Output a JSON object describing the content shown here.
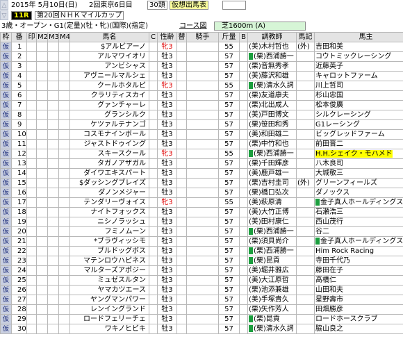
{
  "header": {
    "date": "2015年 5月10日(日)",
    "meeting": "2回東京6日目",
    "heads": "30頭",
    "status": "仮想出馬表",
    "race_no": "11R",
    "race_name": "第20回ＮＨＫマイルカップ",
    "conditions": "3歳・オープン・G1(定量)(牡・牝)(国際)(指定)",
    "course_label": "コース図",
    "course": "芝1600m (A)",
    "nav_up": "△",
    "nav_down": "▽"
  },
  "columns": [
    "枠",
    "番",
    "印",
    "M2",
    "M3",
    "M4",
    "馬名",
    "C",
    "性齢",
    "替",
    "騎手",
    "斤量",
    "B",
    "調教師",
    "馬記",
    "馬主"
  ],
  "rows": [
    {
      "waku": "仮",
      "ban": "1",
      "name": "$アルビアーノ",
      "sex": "牝3",
      "f": true,
      "kin": "55",
      "tr": "(美)木村哲也",
      "mark": false,
      "note": "(外)",
      "owner": "吉田和美",
      "hl": false
    },
    {
      "waku": "仮",
      "ban": "2",
      "name": "アルマワイオリ",
      "sex": "牡3",
      "f": false,
      "kin": "57",
      "tr": "(栗)西浦勝一",
      "mark": true,
      "note": "",
      "owner": "コウトミックレーシング",
      "hl": false
    },
    {
      "waku": "仮",
      "ban": "3",
      "name": "アンビシャス",
      "sex": "牡3",
      "f": false,
      "kin": "57",
      "tr": "(栗)音無秀孝",
      "mark": false,
      "note": "",
      "owner": "近藤英子",
      "hl": false
    },
    {
      "waku": "仮",
      "ban": "4",
      "name": "アヴニールマルシェ",
      "sex": "牡3",
      "f": false,
      "kin": "57",
      "tr": "(美)藤沢和雄",
      "mark": false,
      "note": "",
      "owner": "キャロットファーム",
      "hl": false
    },
    {
      "waku": "仮",
      "ban": "5",
      "name": "クールホタルビ",
      "sex": "牝3",
      "f": true,
      "kin": "55",
      "tr": "(栗)清水久詞",
      "mark": true,
      "note": "",
      "owner": "川上哲司",
      "hl": false
    },
    {
      "waku": "仮",
      "ban": "6",
      "name": "クラリティスカイ",
      "sex": "牡3",
      "f": false,
      "kin": "57",
      "tr": "(栗)友道康夫",
      "mark": false,
      "note": "",
      "owner": "杉山忠国",
      "hl": false
    },
    {
      "waku": "仮",
      "ban": "7",
      "name": "グァンチャーレ",
      "sex": "牡3",
      "f": false,
      "kin": "57",
      "tr": "(栗)北出成人",
      "mark": false,
      "note": "",
      "owner": "松本俊廣",
      "hl": false
    },
    {
      "waku": "仮",
      "ban": "8",
      "name": "グランシルク",
      "sex": "牡3",
      "f": false,
      "kin": "57",
      "tr": "(美)戸田博文",
      "mark": false,
      "note": "",
      "owner": "シルクレーシング",
      "hl": false
    },
    {
      "waku": "仮",
      "ban": "9",
      "name": "ケツァルテナンゴ",
      "sex": "牡3",
      "f": false,
      "kin": "57",
      "tr": "(栗)笹田和秀",
      "mark": false,
      "note": "",
      "owner": "G1レーシング",
      "hl": false
    },
    {
      "waku": "仮",
      "ban": "10",
      "name": "コスモナインボール",
      "sex": "牡3",
      "f": false,
      "kin": "57",
      "tr": "(美)和田雄二",
      "mark": false,
      "note": "",
      "owner": "ビッグレッドファーム",
      "hl": false
    },
    {
      "waku": "仮",
      "ban": "11",
      "name": "ジャストドゥイング",
      "sex": "牡3",
      "f": false,
      "kin": "57",
      "tr": "(栗)中竹和也",
      "mark": false,
      "note": "",
      "owner": "前田晋二",
      "hl": false
    },
    {
      "waku": "仮",
      "ban": "12",
      "name": "スキースクール",
      "sex": "牝3",
      "f": true,
      "kin": "55",
      "tr": "(栗)西浦勝一",
      "mark": true,
      "note": "",
      "owner": "H.H.シェイク・モハメド",
      "hl": true
    },
    {
      "waku": "仮",
      "ban": "13",
      "name": "タガノアザガル",
      "sex": "牡3",
      "f": false,
      "kin": "57",
      "tr": "(栗)千田輝彦",
      "mark": false,
      "note": "",
      "owner": "八木良司",
      "hl": false
    },
    {
      "waku": "仮",
      "ban": "14",
      "name": "ダイワエキスパート",
      "sex": "牡3",
      "f": false,
      "kin": "57",
      "tr": "(美)鹿戸雄一",
      "mark": false,
      "note": "",
      "owner": "大城敬三",
      "hl": false
    },
    {
      "waku": "仮",
      "ban": "15",
      "name": "$ダッシングブレイズ",
      "sex": "牡3",
      "f": false,
      "kin": "57",
      "tr": "(栗)吉村圭司",
      "mark": false,
      "note": "(外)",
      "owner": "グリーンフィールズ",
      "hl": false
    },
    {
      "waku": "仮",
      "ban": "16",
      "name": "ダノンメジャー",
      "sex": "牡3",
      "f": false,
      "kin": "57",
      "tr": "(栗)橋口弘次",
      "mark": false,
      "note": "",
      "owner": "ダノックス",
      "hl": false
    },
    {
      "waku": "仮",
      "ban": "17",
      "name": "テンダリーヴォイス",
      "sex": "牝3",
      "f": true,
      "kin": "55",
      "tr": "(美)萩原清",
      "mark": false,
      "note": "",
      "owner": "金子真人ホールディングス",
      "hl": false,
      "ownermark": true
    },
    {
      "waku": "仮",
      "ban": "18",
      "name": "ナイトフォックス",
      "sex": "牡3",
      "f": false,
      "kin": "57",
      "tr": "(美)大竹正博",
      "mark": false,
      "note": "",
      "owner": "石瀬浩三",
      "hl": false
    },
    {
      "waku": "仮",
      "ban": "19",
      "name": "ニシノラッシュ",
      "sex": "牡3",
      "f": false,
      "kin": "57",
      "tr": "(美)田村康仁",
      "mark": false,
      "note": "",
      "owner": "西山茂行",
      "hl": false
    },
    {
      "waku": "仮",
      "ban": "20",
      "name": "フミノムーン",
      "sex": "牡3",
      "f": false,
      "kin": "57",
      "tr": "(栗)西浦勝一",
      "mark": true,
      "note": "",
      "owner": "谷二",
      "hl": false
    },
    {
      "waku": "仮",
      "ban": "21",
      "name": "*ブラヴィッシモ",
      "sex": "牡3",
      "f": false,
      "kin": "57",
      "tr": "(栗)須貝尚介",
      "mark": false,
      "note": "",
      "owner": "金子真人ホールディングス",
      "hl": false,
      "ownermark": true
    },
    {
      "waku": "仮",
      "ban": "22",
      "name": "ブルドッグボス",
      "sex": "牡3",
      "f": false,
      "kin": "57",
      "tr": "(栗)西浦勝一",
      "mark": true,
      "note": "",
      "owner": "Him Rock Racing",
      "hl": false
    },
    {
      "waku": "仮",
      "ban": "23",
      "name": "マテンロウハピネス",
      "sex": "牡3",
      "f": false,
      "kin": "57",
      "tr": "(栗)昆貢",
      "mark": true,
      "note": "",
      "owner": "寺田千代乃",
      "hl": false
    },
    {
      "waku": "仮",
      "ban": "24",
      "name": "マルターズアポジー",
      "sex": "牡3",
      "f": false,
      "kin": "57",
      "tr": "(美)堀井雅広",
      "mark": false,
      "note": "",
      "owner": "藤田在子",
      "hl": false
    },
    {
      "waku": "仮",
      "ban": "25",
      "name": "ミュゼスルタン",
      "sex": "牡3",
      "f": false,
      "kin": "57",
      "tr": "(美)大江原哲",
      "mark": false,
      "note": "",
      "owner": "高橋仁",
      "hl": false
    },
    {
      "waku": "仮",
      "ban": "26",
      "name": "ヤマカツエース",
      "sex": "牡3",
      "f": false,
      "kin": "57",
      "tr": "(栗)池添兼雄",
      "mark": false,
      "note": "",
      "owner": "山田和夫",
      "hl": false
    },
    {
      "waku": "仮",
      "ban": "27",
      "name": "ヤングマンパワー",
      "sex": "牡3",
      "f": false,
      "kin": "57",
      "tr": "(美)手塚貴久",
      "mark": false,
      "note": "",
      "owner": "星野壽市",
      "hl": false
    },
    {
      "waku": "仮",
      "ban": "28",
      "name": "レンイングランド",
      "sex": "牡3",
      "f": false,
      "kin": "57",
      "tr": "(栗)矢作芳人",
      "mark": false,
      "note": "",
      "owner": "田畑勝彦",
      "hl": false
    },
    {
      "waku": "仮",
      "ban": "29",
      "name": "ロードフェリーチェ",
      "sex": "牡3",
      "f": false,
      "kin": "57",
      "tr": "(栗)昆貢",
      "mark": true,
      "note": "",
      "owner": "ロードホースクラブ",
      "hl": false
    },
    {
      "waku": "仮",
      "ban": "30",
      "name": "ワキノヒビキ",
      "sex": "牡3",
      "f": false,
      "kin": "57",
      "tr": "(栗)清水久詞",
      "mark": true,
      "note": "",
      "owner": "脇山良之",
      "hl": false
    }
  ]
}
